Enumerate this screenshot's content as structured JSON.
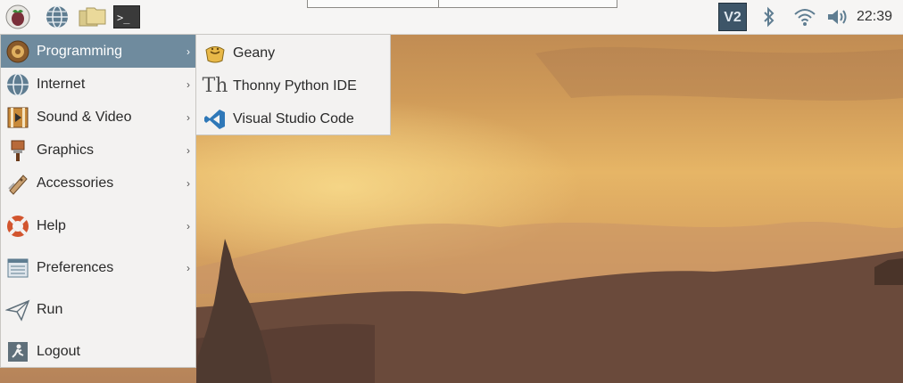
{
  "clock": "22:39",
  "colors": {
    "menu_highlight": "#6f8b9e",
    "menu_bg": "#f3f2f1",
    "taskbar_bg": "#f6f5f4"
  },
  "taskbar": {
    "launchers": [
      "raspberry-icon",
      "web-browser-icon",
      "file-manager-icon",
      "terminal-icon"
    ],
    "tray": [
      "vnc-icon",
      "bluetooth-icon",
      "wifi-icon",
      "volume-icon"
    ],
    "terminal_glyph": ">_",
    "vnc_glyph": "V2"
  },
  "main_menu": {
    "items": [
      {
        "label": "Programming",
        "icon": "programming-icon",
        "submenu": true,
        "active": true
      },
      {
        "label": "Internet",
        "icon": "globe-icon",
        "submenu": true
      },
      {
        "label": "Sound & Video",
        "icon": "film-icon",
        "submenu": true
      },
      {
        "label": "Graphics",
        "icon": "paintbrush-icon",
        "submenu": true
      },
      {
        "label": "Accessories",
        "icon": "pocketknife-icon",
        "submenu": true
      },
      {
        "label": "Help",
        "icon": "lifebuoy-icon",
        "submenu": true
      },
      {
        "label": "Preferences",
        "icon": "preferences-icon",
        "submenu": true
      },
      {
        "label": "Run",
        "icon": "paper-plane-icon",
        "submenu": false
      },
      {
        "label": "Logout",
        "icon": "exit-icon",
        "submenu": false
      }
    ],
    "arrow": "›"
  },
  "sub_menu": {
    "items": [
      {
        "label": "Geany",
        "icon": "geany-icon"
      },
      {
        "label": "Thonny Python IDE",
        "icon": "thonny-icon",
        "glyph": "Th"
      },
      {
        "label": "Visual Studio Code",
        "icon": "vscode-icon"
      }
    ]
  }
}
